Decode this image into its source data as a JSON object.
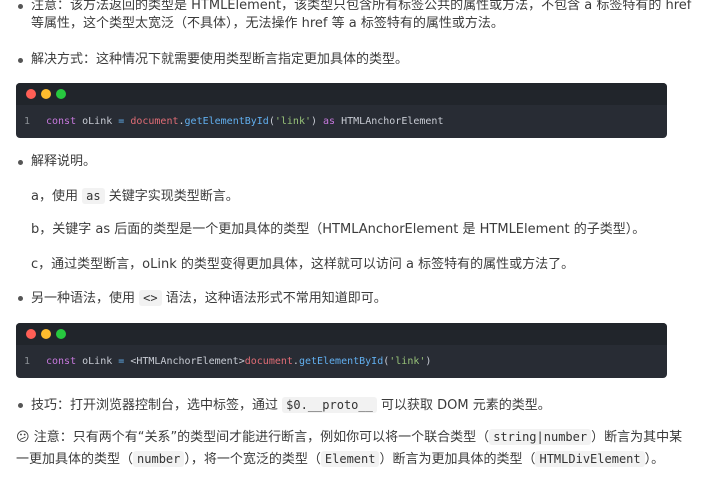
{
  "p1": {
    "line1": "注意：该方法返回的类型是 HTMLElement，该类型只包含所有标签公共的属性或方法，不包含 a 标签特有的 href",
    "line2": "等属性，这个类型太宽泛（不具体），无法操作 href 等 a 标签特有的属性或方法。"
  },
  "p2": {
    "text": "解决方式：这种情况下就需要使用类型断言指定更加具体的类型。"
  },
  "code1": {
    "line_no": "1",
    "tokens": [
      "const",
      " oLink ",
      "=",
      " ",
      "document",
      ".",
      "getElementById",
      "(",
      "'link'",
      ")",
      " as ",
      "HTMLAnchorElement"
    ]
  },
  "p3": {
    "text": "解释说明。"
  },
  "a_item": {
    "pre": "a，使用",
    "code": "as",
    "post": "关键字实现类型断言。"
  },
  "b_item": {
    "text": "b，关键字 as 后面的类型是一个更加具体的类型（HTMLAnchorElement 是 HTMLElement 的子类型）。"
  },
  "c_item": {
    "text": "c，通过类型断言，oLink 的类型变得更加具体，这样就可以访问 a 标签特有的属性或方法了。"
  },
  "p4": {
    "pre": "另一种语法，使用",
    "code": "<>",
    "post": "语法，这种语法形式不常用知道即可。"
  },
  "code2": {
    "line_no": "1",
    "tokens": [
      "const",
      " oLink ",
      "=",
      " <",
      "HTMLAnchorElement",
      ">",
      "document",
      ".",
      "getElementById",
      "(",
      "'link'",
      ")"
    ]
  },
  "p5": {
    "pre": "技巧：打开浏览器控制台，选中标签，通过",
    "code": "$0.__proto__",
    "post": "可以获取 DOM 元素的类型。"
  },
  "note": {
    "emoji": "😕",
    "l1_pre": "注意：只有两个有“关系”的类型间才能进行断言，例如你可以将一个联合类型（",
    "l1_code": "string|number",
    "l1_post": "）断言为其中某",
    "l2_pre": "一更加具体的类型（",
    "l2_code1": "number",
    "l2_mid1": "），将一个宽泛的类型（",
    "l2_code2": "Element",
    "l2_mid2": "）断言为更加具体的类型（",
    "l2_code3": "HTMLDivElement",
    "l2_post": "）。"
  }
}
